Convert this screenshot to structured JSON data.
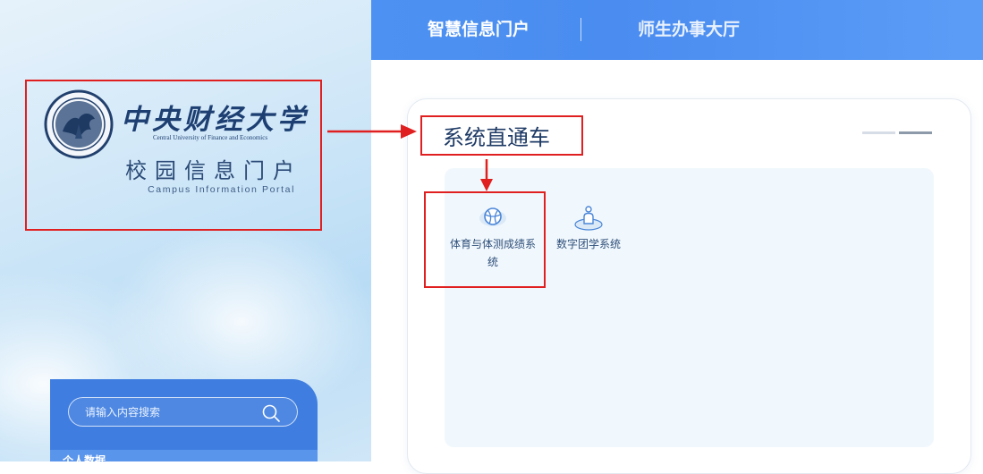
{
  "logo": {
    "name_cn": "中央财经大学",
    "name_en": "Central University of Finance and Economics",
    "portal_cn": "校园信息门户",
    "portal_en": "Campus Information Portal"
  },
  "nav": {
    "items": [
      {
        "label": "智慧信息门户"
      },
      {
        "label": "师生办事大厅"
      }
    ]
  },
  "search": {
    "placeholder": "请输入内容搜索"
  },
  "sidebar": {
    "section_label": "个人数据"
  },
  "card": {
    "title": "系统直通车",
    "apps": [
      {
        "label": "体育与体测成绩系统",
        "icon": "basketball-icon"
      },
      {
        "label": "数字团学系统",
        "icon": "person-icon"
      }
    ]
  },
  "colors": {
    "header": "#4d92f2",
    "search_panel": "#3f7ee0",
    "highlight": "#e02020",
    "tiles_bg": "#f1f8fd"
  }
}
